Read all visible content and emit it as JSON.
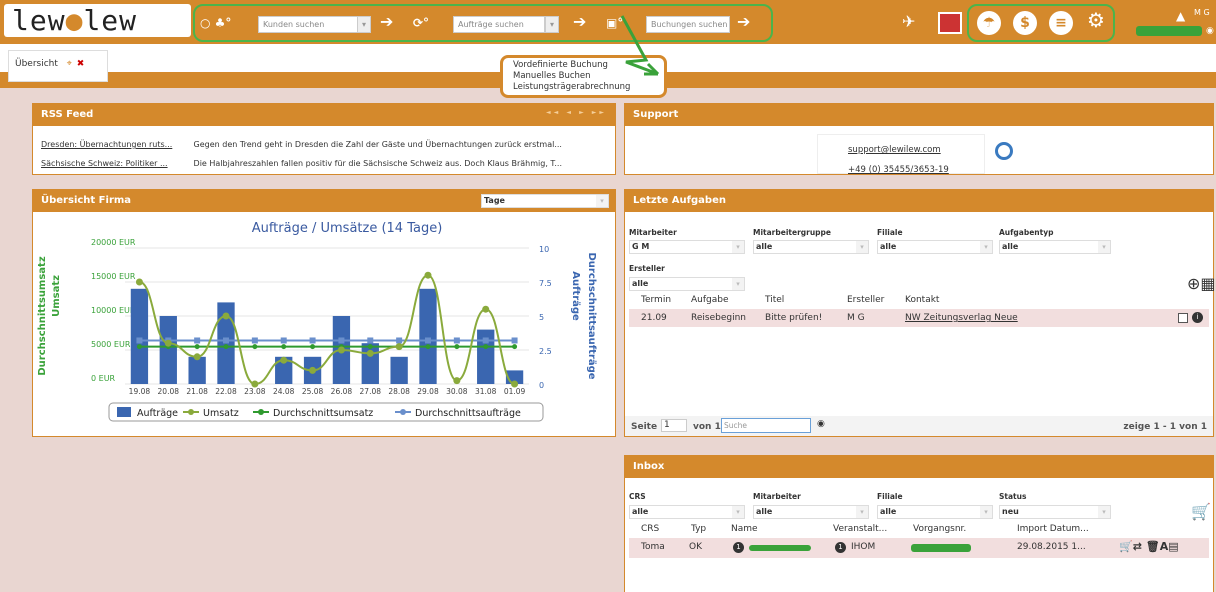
{
  "topbar": {
    "logo": "lewolew",
    "search_customers_placeholder": "Kunden suchen",
    "search_orders_placeholder": "Aufträge suchen",
    "search_bookings_placeholder": "Buchungen suchen",
    "user_initials": "M G"
  },
  "tabs": [
    {
      "label": "Übersicht"
    }
  ],
  "booking_menu": {
    "items": [
      "Vordefinierte Buchung",
      "Manuelles Buchen",
      "Leistungsträgerabrechnung"
    ]
  },
  "rss": {
    "title": "RSS Feed",
    "rows": [
      {
        "title": "Dresden: Übernachtungen ruts...",
        "text": "Gegen den Trend geht in Dresden die Zahl der Gäste und Übernachtungen zurück erstmal..."
      },
      {
        "title": "Sächsische Schweiz: Politiker ...",
        "text": "Die Halbjahreszahlen fallen positiv für die Sächsische Schweiz aus. Doch Klaus Brähmig, T..."
      }
    ]
  },
  "support": {
    "title": "Support",
    "email": "support@lewilew.com",
    "phone": "+49 (0) 35455/3653-19"
  },
  "overview": {
    "title": "Übersicht Firma",
    "period": "Tage"
  },
  "chart_data": {
    "type": "bar",
    "title": "Aufträge / Umsätze (14 Tage)",
    "categories": [
      "19.08",
      "20.08",
      "21.08",
      "22.08",
      "23.08",
      "24.08",
      "25.08",
      "26.08",
      "27.08",
      "28.08",
      "29.08",
      "30.08",
      "31.08",
      "01.09"
    ],
    "y_left_ticks": [
      "20000 EUR",
      "15000 EUR",
      "10000 EUR",
      "5000 EUR",
      "0 EUR"
    ],
    "y_right_ticks": [
      "10",
      "7.5",
      "5",
      "2.5",
      "0"
    ],
    "ylabel_left_outer": "Durchschnittsumsatz",
    "ylabel_left_inner": "Umsatz",
    "ylabel_right_outer": "Durchschnittsaufträge",
    "ylabel_right_inner": "Aufträge",
    "ylim_left": [
      0,
      20000
    ],
    "ylim_right": [
      0,
      10
    ],
    "series": [
      {
        "name": "Aufträge",
        "type": "bar",
        "axis": "right",
        "values": [
          7,
          5,
          2,
          6,
          0,
          2,
          2,
          5,
          3,
          2,
          7,
          0,
          4,
          1
        ]
      },
      {
        "name": "Umsatz",
        "type": "line",
        "axis": "left",
        "values": [
          15000,
          6000,
          4000,
          10000,
          0,
          3500,
          2000,
          5000,
          4500,
          5500,
          16000,
          500,
          11000,
          0
        ]
      },
      {
        "name": "Durchschnittsumsatz",
        "type": "line",
        "axis": "left",
        "values": [
          5500,
          5500,
          5500,
          5500,
          5500,
          5500,
          5500,
          5500,
          5500,
          5500,
          5500,
          5500,
          5500,
          5500
        ]
      },
      {
        "name": "Durchschnittsaufträge",
        "type": "line",
        "axis": "right",
        "values": [
          3.2,
          3.2,
          3.2,
          3.2,
          3.2,
          3.2,
          3.2,
          3.2,
          3.2,
          3.2,
          3.2,
          3.2,
          3.2,
          3.2
        ]
      }
    ],
    "colors": {
      "bars": "#3a66b0",
      "umsatz": "#8aaa3c",
      "avg_umsatz": "#2f9a2f",
      "avg_auftraege": "#6a8fcc"
    },
    "legend": "bottom"
  },
  "tasks": {
    "title": "Letzte Aufgaben",
    "filters": {
      "mitarbeiter_label": "Mitarbeiter",
      "mitarbeiter_value": "G M",
      "gruppe_label": "Mitarbeitergruppe",
      "gruppe_value": "alle",
      "filiale_label": "Filiale",
      "filiale_value": "alle",
      "typ_label": "Aufgabentyp",
      "typ_value": "alle",
      "ersteller_label": "Ersteller",
      "ersteller_value": "alle"
    },
    "columns": [
      "Termin",
      "Aufgabe",
      "Titel",
      "Ersteller",
      "Kontakt"
    ],
    "rows": [
      {
        "termin": "21.09",
        "aufgabe": "Reisebeginn",
        "titel": "Bitte prüfen!",
        "ersteller": "M G",
        "kontakt": "NW Zeitungsverlag Neue"
      }
    ],
    "pager": {
      "seite_label": "Seite",
      "seite_value": "1",
      "von": "von 1",
      "search_placeholder": "Suche",
      "summary": "zeige 1 - 1 von 1"
    }
  },
  "inbox": {
    "title": "Inbox",
    "filters": {
      "crs_label": "CRS",
      "crs_value": "alle",
      "mitarbeiter_label": "Mitarbeiter",
      "mitarbeiter_value": "alle",
      "filiale_label": "Filiale",
      "filiale_value": "alle",
      "status_label": "Status",
      "status_value": "neu"
    },
    "columns": [
      "CRS",
      "Typ",
      "Name",
      "Veranstalt...",
      "Vorgangsnr.",
      "Import Datum..."
    ],
    "rows": [
      {
        "crs": "Toma",
        "typ": "OK",
        "name_badge": "1",
        "veranstalter_badge": "1",
        "veranstalter": "IHOM",
        "datum": "29.08.2015 1..."
      }
    ]
  }
}
